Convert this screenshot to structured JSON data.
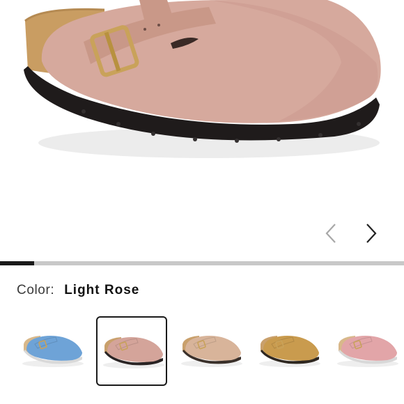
{
  "product": {
    "color_label": "Color:",
    "selected_color": "Light Rose"
  },
  "gallery": {
    "progress": 0.085,
    "prev_icon": "chevron-left-icon",
    "next_icon": "chevron-right-icon"
  },
  "swatches": [
    {
      "name": "blue",
      "upper": "#6ea3d7",
      "sole": "#d9d9d9",
      "footbed": "#d8b88a",
      "selected": false
    },
    {
      "name": "light-rose",
      "upper": "#d4a49a",
      "sole": "#2a2424",
      "footbed": "#c9a06c",
      "selected": true
    },
    {
      "name": "sand",
      "upper": "#d8b49a",
      "sole": "#3a302a",
      "footbed": "#c9a06c",
      "selected": false
    },
    {
      "name": "ochre",
      "upper": "#c99b4e",
      "sole": "#2e2720",
      "footbed": "#c9a06c",
      "selected": false
    },
    {
      "name": "pink",
      "upper": "#e2a5a8",
      "sole": "#d8d8d8",
      "footbed": "#d8b88a",
      "selected": false
    }
  ],
  "colors": {
    "accent": "#1a1a1a",
    "track": "#c8c8c8",
    "chevron_inactive": "#a8a8a8",
    "chevron_active": "#222222"
  }
}
